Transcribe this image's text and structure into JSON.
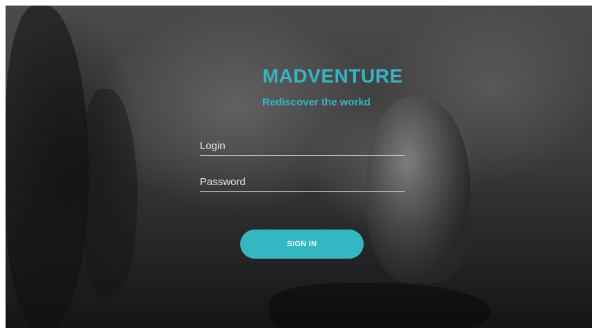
{
  "brand": {
    "title": "MADVENTURE",
    "tagline": "Rediscover the workd"
  },
  "form": {
    "login_placeholder": "Login",
    "password_placeholder": "Password",
    "submit_label": "SIGN IN"
  },
  "colors": {
    "accent": "#33b7c3",
    "input_underline": "#d9d9d9",
    "text": "#ffffff"
  }
}
